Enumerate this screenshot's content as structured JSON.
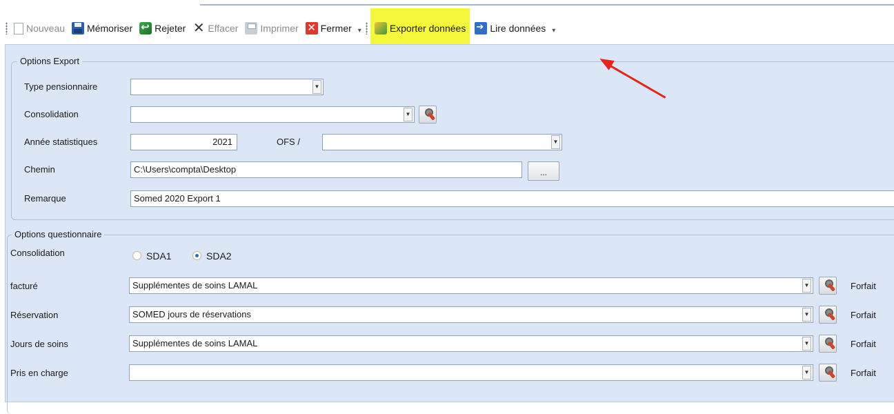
{
  "toolbar": {
    "nouveau": "Nouveau",
    "memoriser": "Mémoriser",
    "rejeter": "Rejeter",
    "effacer": "Effacer",
    "imprimer": "Imprimer",
    "fermer": "Fermer",
    "exporter": "Exporter données",
    "lire": "Lire données",
    "highlight_color": "#f4f73a"
  },
  "export": {
    "legend": "Options Export",
    "type_label": "Type pensionnaire",
    "type_value": "",
    "consolidation_label": "Consolidation",
    "consolidation_value": "",
    "annee_label": "Année statistiques",
    "annee_value": "2021",
    "ofs_label": "OFS /",
    "ofs_value": "",
    "chemin_label": "Chemin",
    "chemin_value": "C:\\Users\\compta\\Desktop",
    "browse_label": "...",
    "remarque_label": "Remarque",
    "remarque_value": "Somed 2020 Export 1"
  },
  "questionnaire": {
    "legend": "Options questionnaire",
    "consolidation_label": "Consolidation",
    "radio_sda1": "SDA1",
    "radio_sda2": "SDA2",
    "selected": "SDA2",
    "rows": [
      {
        "label": "facturé",
        "value": "Supplémentes de soins LAMAL",
        "suffix": "Forfait"
      },
      {
        "label": "Réservation",
        "value": "SOMED jours de réservations",
        "suffix": "Forfait"
      },
      {
        "label": "Jours de soins",
        "value": "Supplémentes de soins LAMAL",
        "suffix": "Forfait"
      },
      {
        "label": "Pris en charge",
        "value": "",
        "suffix": "Forfait"
      }
    ]
  },
  "icons": {
    "annotation_arrow": "red-arrow-icon",
    "arrow_color": "#e5241a"
  }
}
